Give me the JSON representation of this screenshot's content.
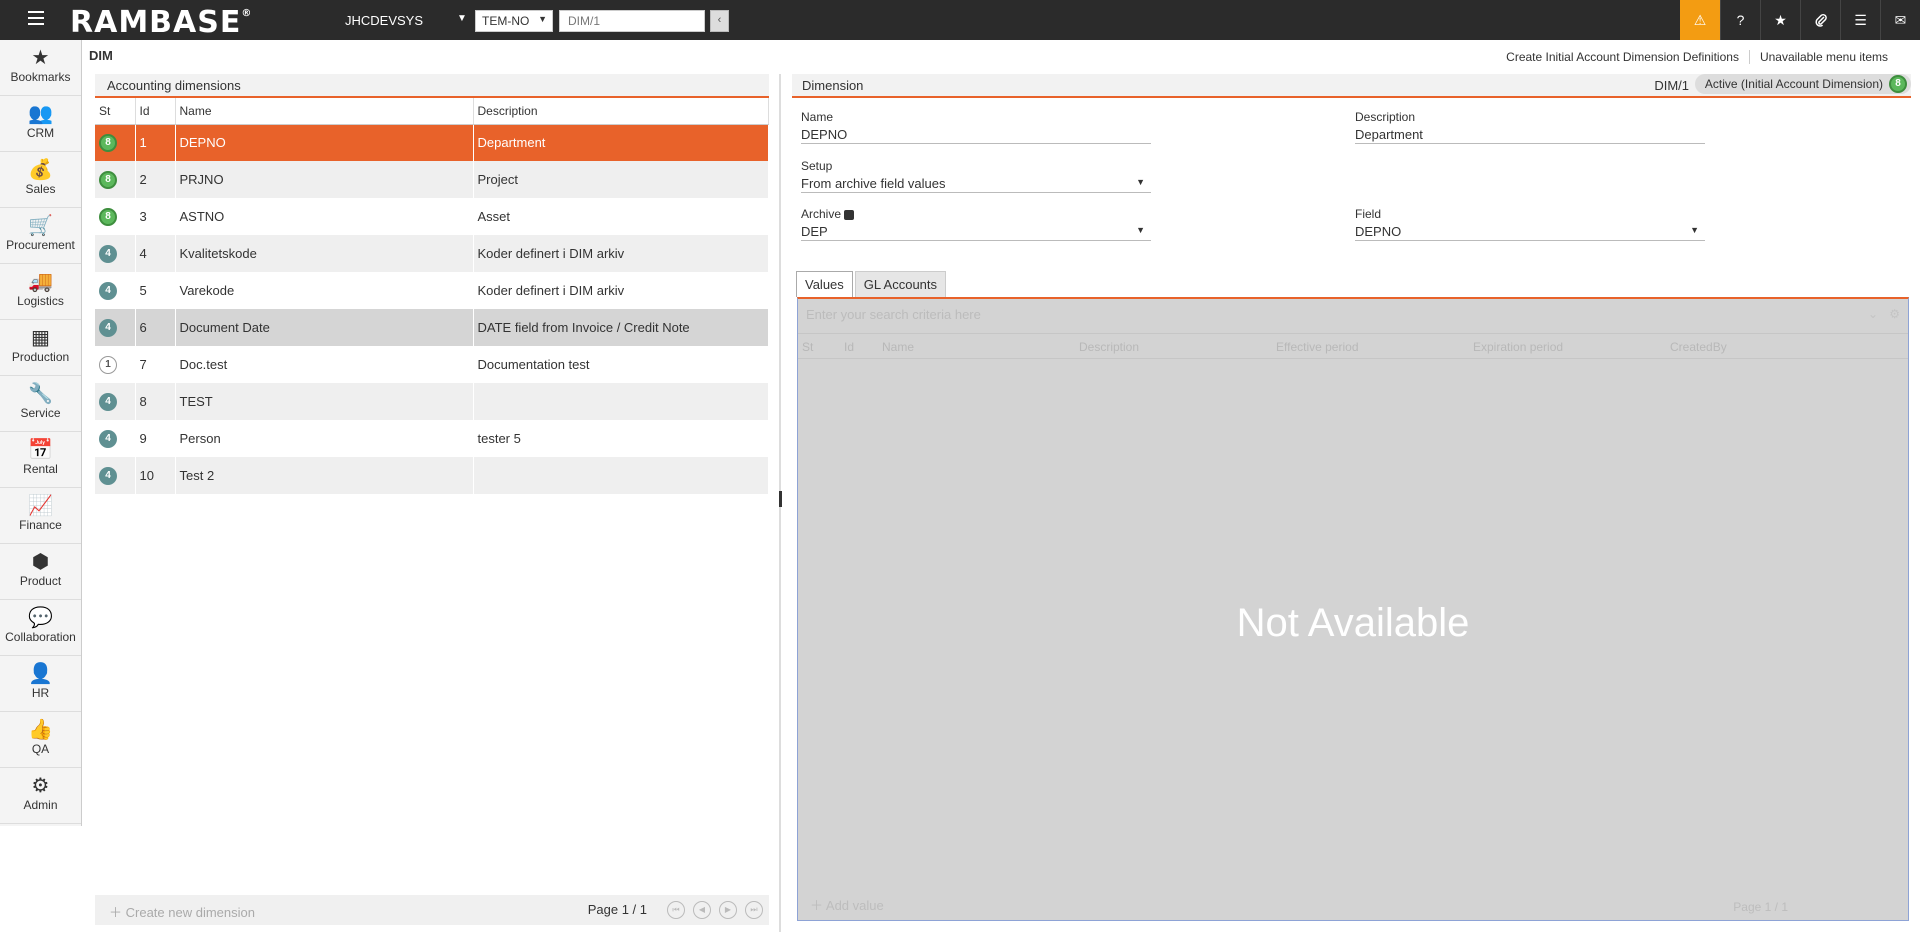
{
  "header": {
    "logo": "RAMBASE",
    "system": "JHCDEVSYS",
    "company": "TEM-NO",
    "goto_value": "DIM/1",
    "icons": [
      "alert-icon",
      "help-icon",
      "star-icon",
      "paperclip-icon",
      "list-icon",
      "mail-icon"
    ]
  },
  "sidebar": {
    "items": [
      {
        "label": "Bookmarks",
        "icon": "star-icon"
      },
      {
        "label": "CRM",
        "icon": "people-icon"
      },
      {
        "label": "Sales",
        "icon": "money-bag-icon"
      },
      {
        "label": "Procurement",
        "icon": "cart-icon"
      },
      {
        "label": "Logistics",
        "icon": "truck-icon"
      },
      {
        "label": "Production",
        "icon": "boxes-icon"
      },
      {
        "label": "Service",
        "icon": "wrench-icon"
      },
      {
        "label": "Rental",
        "icon": "calendar-money-icon"
      },
      {
        "label": "Finance",
        "icon": "chart-line-icon"
      },
      {
        "label": "Product",
        "icon": "cube-icon"
      },
      {
        "label": "Collaboration",
        "icon": "chat-icon"
      },
      {
        "label": "HR",
        "icon": "person-icon"
      },
      {
        "label": "QA",
        "icon": "thumbs-up-icon"
      },
      {
        "label": "Admin",
        "icon": "gear-icon"
      }
    ]
  },
  "page": {
    "title": "DIM",
    "links": [
      "Create Initial Account Dimension Definitions",
      "Unavailable menu items"
    ]
  },
  "left": {
    "title": "Accounting dimensions",
    "columns": [
      "St",
      "Id",
      "Name",
      "Description"
    ],
    "rows": [
      {
        "st": "8",
        "id": "1",
        "name": "DEPNO",
        "desc": "Department"
      },
      {
        "st": "8",
        "id": "2",
        "name": "PRJNO",
        "desc": "Project"
      },
      {
        "st": "8",
        "id": "3",
        "name": "ASTNO",
        "desc": "Asset"
      },
      {
        "st": "4",
        "id": "4",
        "name": "Kvalitetskode",
        "desc": "Koder definert i DIM arkiv"
      },
      {
        "st": "4",
        "id": "5",
        "name": "Varekode",
        "desc": "Koder definert i DIM arkiv"
      },
      {
        "st": "4",
        "id": "6",
        "name": "Document Date",
        "desc": "DATE field from Invoice / Credit Note"
      },
      {
        "st": "1",
        "id": "7",
        "name": "Doc.test",
        "desc": "Documentation test"
      },
      {
        "st": "4",
        "id": "8",
        "name": "TEST",
        "desc": ""
      },
      {
        "st": "4",
        "id": "9",
        "name": "Person",
        "desc": "tester 5"
      },
      {
        "st": "4",
        "id": "10",
        "name": "Test 2",
        "desc": ""
      }
    ],
    "footer": {
      "create": "Create new dimension",
      "page": "Page 1 / 1"
    }
  },
  "right": {
    "title": "Dimension",
    "dim_id": "DIM/1",
    "status_label": "Active (Initial Account Dimension)",
    "status_code": "8",
    "fields": {
      "name_label": "Name",
      "name_value": "DEPNO",
      "description_label": "Description",
      "description_value": "Department",
      "setup_label": "Setup",
      "setup_value": "From archive field values",
      "archive_label": "Archive",
      "archive_value": "DEP",
      "field_label": "Field",
      "field_value": "DEPNO"
    },
    "tabs": [
      "Values",
      "GL Accounts"
    ],
    "values_grid": {
      "search_placeholder": "Enter your search criteria here",
      "columns": [
        "St",
        "Id",
        "Name",
        "Description",
        "Effective period",
        "Expiration period",
        "CreatedBy"
      ],
      "overlay": "Not Available",
      "add": "Add value",
      "page": "Page 1 / 1"
    }
  }
}
